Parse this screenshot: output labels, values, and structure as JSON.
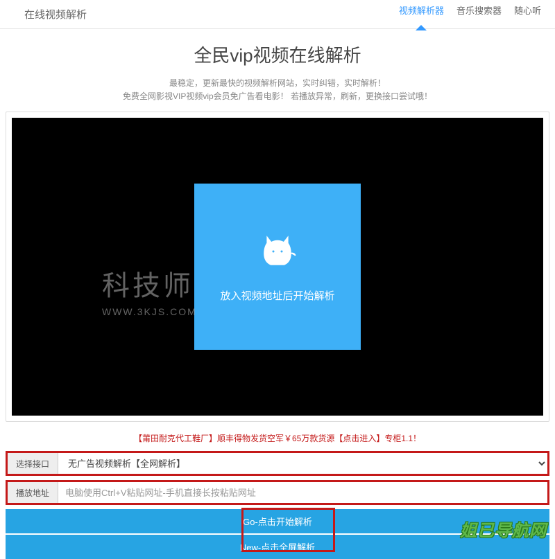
{
  "header": {
    "brand": "在线视频解析",
    "nav": [
      {
        "label": "视频解析器",
        "active": true
      },
      {
        "label": "音乐搜索器",
        "active": false
      },
      {
        "label": "随心听",
        "active": false
      }
    ]
  },
  "main": {
    "title": "全民vip视频在线解析",
    "subtitle_line1": "最稳定，更新最快的视频解析网站，实时纠错，实时解析！",
    "subtitle_line2": "免费全网影视VIP视频vip会员免广告看电影！ 若播放异常，刷新，更换接口尝试哦！"
  },
  "player": {
    "placeholder_text": "放入视频地址后开始解析"
  },
  "watermark": {
    "main": "科技师",
    "sub": "WWW.3KJS.COM"
  },
  "ad": {
    "text": "【莆田耐克代工鞋厂】顺丰得物发货空军￥65万款货源【点击进入】专柜1.1！"
  },
  "form": {
    "interface_label": "选择接口",
    "interface_value": "无广告视频解析【全网解析】",
    "address_label": "播放地址",
    "address_placeholder": "电脑使用Ctrl+V粘贴网址-手机直接长按粘贴网址"
  },
  "buttons": {
    "go": "Go-点击开始解析",
    "new": "New-点击全屏解析"
  },
  "footer_watermark": "姐已导航网"
}
